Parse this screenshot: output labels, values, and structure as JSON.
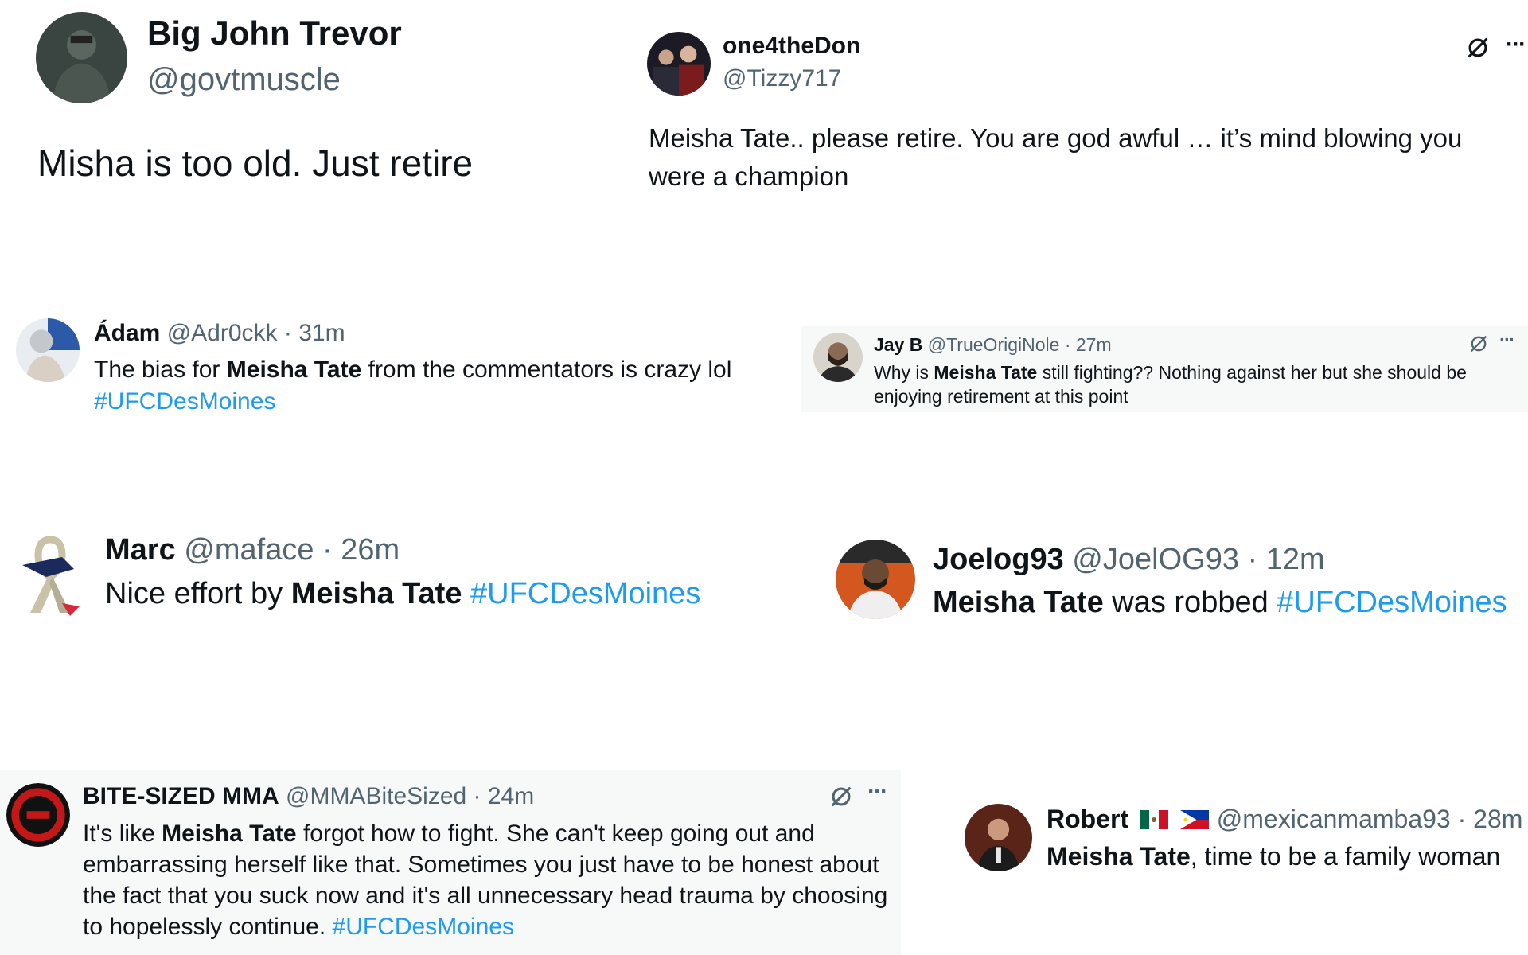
{
  "tweets": [
    {
      "name": "Big John Trevor",
      "handle": "@govtmuscle",
      "text": "Misha is too old. Just retire"
    },
    {
      "name": "one4theDon",
      "handle": "@Tizzy717",
      "text": "Meisha Tate.. please retire. You are god awful … it’s mind blowing you were a champion",
      "icons": [
        "grok-icon",
        "more-icon"
      ]
    },
    {
      "name": "Ádam",
      "handle": "@Adr0ckk",
      "sep": "·",
      "time": "31m",
      "text_pre": "The bias for",
      "text_bold": "Meisha Tate",
      "text_post": "from the commentators is crazy lol",
      "hashtag": "#UFCDesMoines"
    },
    {
      "name": "Jay B",
      "handle": "@TrueOrigiNole",
      "sep": "·",
      "time": "27m",
      "text_pre": "Why is",
      "text_bold": "Meisha Tate",
      "text_post": "still fighting?? Nothing against her but she should be enjoying retirement at this point",
      "icons": [
        "grok-icon",
        "more-icon"
      ]
    },
    {
      "name": "Marc",
      "handle": "@maface",
      "sep": "·",
      "time": "26m",
      "text_pre": "Nice effort by",
      "text_bold": "Meisha Tate",
      "hashtag": "#UFCDesMoines"
    },
    {
      "name": "Joelog93",
      "handle": "@JoelOG93",
      "sep": "·",
      "time": "12m",
      "text_bold": "Meisha Tate",
      "text_post": "was robbed",
      "hashtag": "#UFCDesMoines"
    },
    {
      "name": "BITE-SIZED MMA",
      "handle": "@MMABiteSized",
      "sep": "·",
      "time": "24m",
      "text_pre": "It's like",
      "text_bold": "Meisha Tate",
      "text_post": "forgot how to fight. She can't keep going out and embarrassing herself like that. Sometimes you just have to be honest about the fact that you suck now and it's all unnecessary head trauma by choosing to hopelessly continue.",
      "hashtag": "#UFCDesMoines",
      "icons": [
        "grok-icon",
        "more-icon"
      ]
    },
    {
      "name": "Robert",
      "flags": [
        "mexico-flag",
        "philippines-flag"
      ],
      "handle": "@mexicanmamba93",
      "sep": "·",
      "time": "28m",
      "text_bold": "Meisha Tate",
      "text_post": ", time to be a family woman"
    }
  ],
  "ui": {
    "more_glyph": "···"
  },
  "colors": {
    "text": "#0f1419",
    "secondary": "#536471",
    "hashtag": "#1d9bf0",
    "gray_card": "#f7f9f9"
  }
}
